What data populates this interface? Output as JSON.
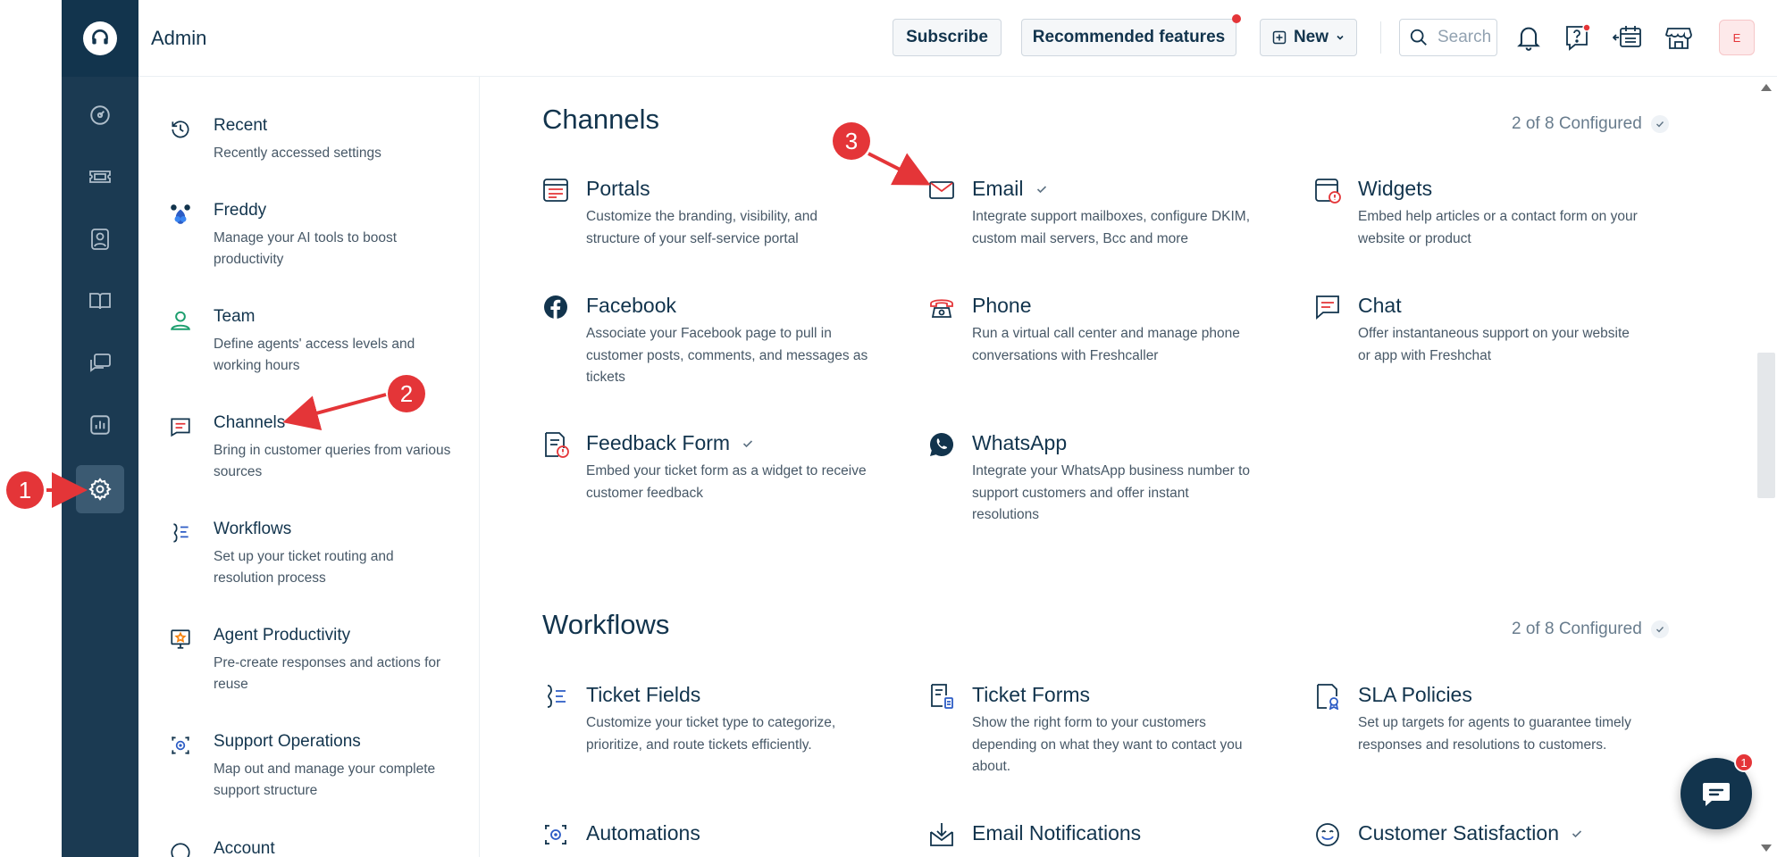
{
  "header": {
    "title": "Admin",
    "subscribe_label": "Subscribe",
    "recommended_label": "Recommended features",
    "new_label": "New",
    "search_placeholder": "Search",
    "avatar_initial": "E"
  },
  "rail": {
    "items": [
      "dashboard-icon",
      "tickets-icon",
      "contacts-icon",
      "solutions-icon",
      "forums-icon",
      "reports-icon",
      "admin-settings-icon"
    ],
    "active": "admin-settings-icon"
  },
  "sidebar": {
    "items": [
      {
        "title": "Recent",
        "desc": "Recently accessed settings",
        "icon": "history-icon"
      },
      {
        "title": "Freddy",
        "desc": "Manage your AI tools to boost productivity",
        "icon": "freddy-icon"
      },
      {
        "title": "Team",
        "desc": "Define agents' access levels and working hours",
        "icon": "team-icon"
      },
      {
        "title": "Channels",
        "desc": "Bring in customer queries from various sources",
        "icon": "channels-icon"
      },
      {
        "title": "Workflows",
        "desc": "Set up your ticket routing and resolution process",
        "icon": "workflows-icon"
      },
      {
        "title": "Agent Productivity",
        "desc": "Pre-create responses and actions for reuse",
        "icon": "agent-productivity-icon"
      },
      {
        "title": "Support Operations",
        "desc": "Map out and manage your complete support structure",
        "icon": "support-operations-icon"
      },
      {
        "title": "Account",
        "desc": "",
        "icon": "account-icon"
      }
    ]
  },
  "channels": {
    "title": "Channels",
    "configured": "2 of 8 Configured",
    "cards": [
      {
        "title": "Portals",
        "desc": "Customize the branding, visibility, and structure of your self-service portal",
        "icon": "portals-icon",
        "configured": false
      },
      {
        "title": "Email",
        "desc": "Integrate support mailboxes, configure DKIM, custom mail servers, Bcc and more",
        "icon": "email-icon",
        "configured": true
      },
      {
        "title": "Widgets",
        "desc": "Embed help articles or a contact form on your website or product",
        "icon": "widgets-icon",
        "configured": false
      },
      {
        "title": "Facebook",
        "desc": "Associate your Facebook page to pull in customer posts, comments, and messages as tickets",
        "icon": "facebook-icon",
        "configured": false
      },
      {
        "title": "Phone",
        "desc": "Run a virtual call center and manage phone conversations with Freshcaller",
        "icon": "phone-icon",
        "configured": false
      },
      {
        "title": "Chat",
        "desc": "Offer instantaneous support on your website or app with Freshchat",
        "icon": "chat-icon",
        "configured": false
      },
      {
        "title": "Feedback Form",
        "desc": "Embed your ticket form as a widget to receive customer feedback",
        "icon": "feedback-form-icon",
        "configured": true
      },
      {
        "title": "WhatsApp",
        "desc": "Integrate your WhatsApp business number to support customers and offer instant resolutions",
        "icon": "whatsapp-icon",
        "configured": false
      }
    ]
  },
  "workflows": {
    "title": "Workflows",
    "configured": "2 of 8 Configured",
    "cards": [
      {
        "title": "Ticket Fields",
        "desc": "Customize your ticket type to categorize, prioritize, and route tickets efficiently.",
        "icon": "ticket-fields-icon",
        "configured": false
      },
      {
        "title": "Ticket Forms",
        "desc": "Show the right form to your customers depending on what they want to contact you about.",
        "icon": "ticket-forms-icon",
        "configured": false
      },
      {
        "title": "SLA Policies",
        "desc": "Set up targets for agents to guarantee timely responses and resolutions to customers.",
        "icon": "sla-policies-icon",
        "configured": false
      },
      {
        "title": "Automations",
        "desc": "",
        "icon": "automations-icon",
        "configured": false
      },
      {
        "title": "Email Notifications",
        "desc": "",
        "icon": "email-notifications-icon",
        "configured": false
      },
      {
        "title": "Customer Satisfaction",
        "desc": "",
        "icon": "customer-satisfaction-icon",
        "configured": true
      }
    ]
  },
  "chat_widget": {
    "badge": "1"
  },
  "annotations": [
    "1",
    "2",
    "3"
  ],
  "colors": {
    "rail": "#1b3a52",
    "accent_red": "#e43538",
    "text": "#12344d"
  }
}
